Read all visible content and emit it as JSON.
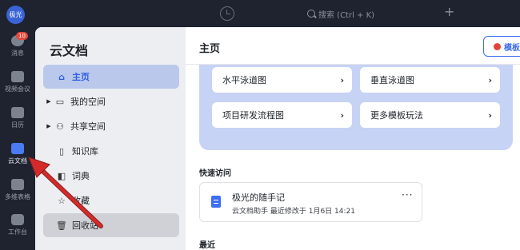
{
  "topbar": {
    "avatar_text": "极光",
    "search_placeholder": "搜索 (Ctrl + K)",
    "add_label": "+"
  },
  "rail": {
    "items": [
      {
        "label": "消息",
        "icon": "message-icon",
        "badge": "10"
      },
      {
        "label": "视频会议",
        "icon": "video-icon"
      },
      {
        "label": "日历",
        "icon": "calendar-icon"
      },
      {
        "label": "云文档",
        "icon": "cloud-doc-icon"
      },
      {
        "label": "多维表格",
        "icon": "table-icon"
      },
      {
        "label": "工作台",
        "icon": "workbench-icon"
      }
    ]
  },
  "sidebar": {
    "title": "云文档",
    "items": [
      {
        "label": "主页",
        "icon": "home-icon"
      },
      {
        "label": "我的空间",
        "icon": "folder-icon"
      },
      {
        "label": "共享空间",
        "icon": "share-icon"
      },
      {
        "label": "知识库",
        "icon": "book-icon"
      },
      {
        "label": "词典",
        "icon": "dictionary-icon"
      },
      {
        "label": "收藏",
        "icon": "star-icon"
      },
      {
        "label": "回收站",
        "icon": "trash-icon"
      }
    ]
  },
  "content": {
    "page_title": "主页",
    "template_button": "模板",
    "templates": [
      {
        "label": "水平泳道图"
      },
      {
        "label": "垂直泳道图"
      },
      {
        "label": "项目研发流程图"
      },
      {
        "label": "更多模板玩法"
      }
    ],
    "quick_access_title": "快速访问",
    "recent_doc": {
      "name": "极光的随手记",
      "meta": "云文档助手  最近修改于 1月6日 14:21",
      "more": "···"
    },
    "recent_title": "最近"
  },
  "colors": {
    "accent": "#3d6df0",
    "active_bg": "#b9c8eb",
    "template_panel": "#c7d3f5",
    "annotation": "#d42a2a"
  }
}
